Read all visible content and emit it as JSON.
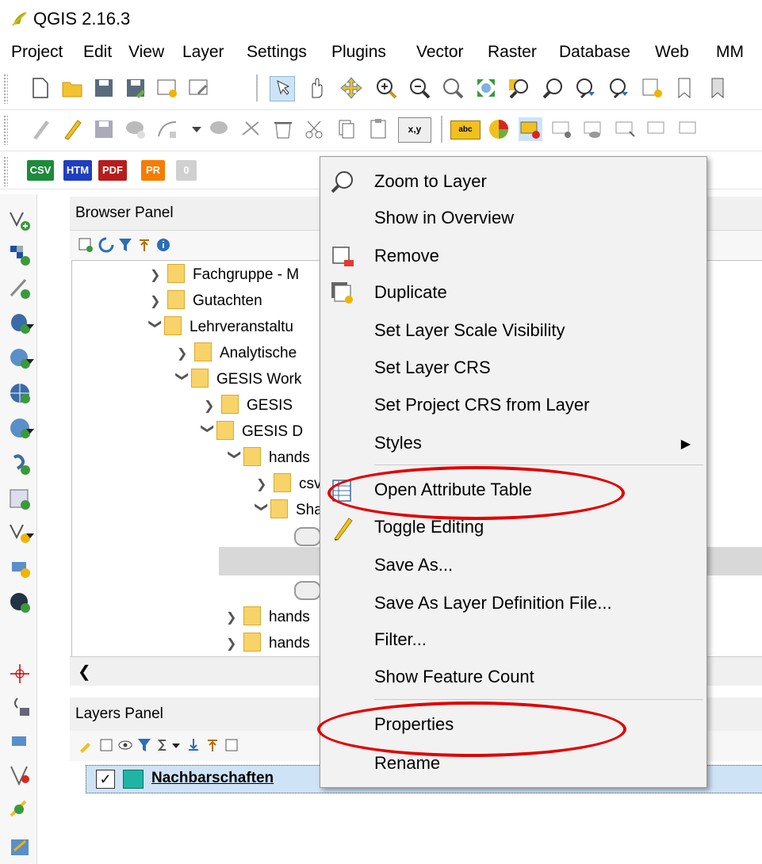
{
  "window": {
    "title": "QGIS 2.16.3"
  },
  "menubar": [
    "Project",
    "Edit",
    "View",
    "Layer",
    "Settings",
    "Plugins",
    "Vector",
    "Raster",
    "Database",
    "Web",
    "MM"
  ],
  "toolbar3": {
    "csv": "CSV",
    "htm": "HTM",
    "pdf": "PDF",
    "pr": "PR",
    "zero": "0"
  },
  "toolbar2": {
    "xy": "x,y",
    "abc": "abc"
  },
  "browser": {
    "title": "Browser Panel",
    "tree": [
      {
        "label": "Fachgruppe - M",
        "expanded": false
      },
      {
        "label": "Gutachten",
        "expanded": false
      },
      {
        "label": "Lehrveranstaltu",
        "expanded": true
      },
      {
        "label": "Analytische",
        "expanded": false
      },
      {
        "label": "GESIS Work",
        "expanded": true
      },
      {
        "label": "GESIS",
        "expanded": false
      },
      {
        "label": "GESIS D",
        "expanded": true
      },
      {
        "label": "hands",
        "expanded": true
      },
      {
        "label": "csv",
        "expanded": false
      },
      {
        "label": "Sha",
        "expanded": true
      },
      {
        "label": "hands",
        "expanded": false
      },
      {
        "label": "hands",
        "expanded": false
      }
    ]
  },
  "layers": {
    "title": "Layers Panel",
    "items": [
      {
        "name": "Nachbarschaften",
        "checked": true,
        "color": "#1fb5a5"
      }
    ]
  },
  "context_menu": {
    "items": [
      {
        "label": "Zoom to Layer",
        "icon": "zoom-icon"
      },
      {
        "label": "Show in Overview"
      },
      {
        "label": "Remove",
        "icon": "remove-layer-icon"
      },
      {
        "label": "Duplicate",
        "icon": "duplicate-icon"
      },
      {
        "label": "Set Layer Scale Visibility"
      },
      {
        "label": "Set Layer CRS"
      },
      {
        "label": "Set Project CRS from Layer"
      },
      {
        "label": "Styles",
        "submenu": true
      },
      {
        "label": "Open Attribute Table",
        "icon": "table-icon"
      },
      {
        "label": "Toggle Editing",
        "icon": "pencil-icon"
      },
      {
        "label": "Save As..."
      },
      {
        "label": "Save As Layer Definition File..."
      },
      {
        "label": "Filter..."
      },
      {
        "label": "Show Feature Count"
      },
      {
        "label": "Properties"
      },
      {
        "label": "Rename"
      }
    ]
  },
  "annotation_color": "#e20000"
}
